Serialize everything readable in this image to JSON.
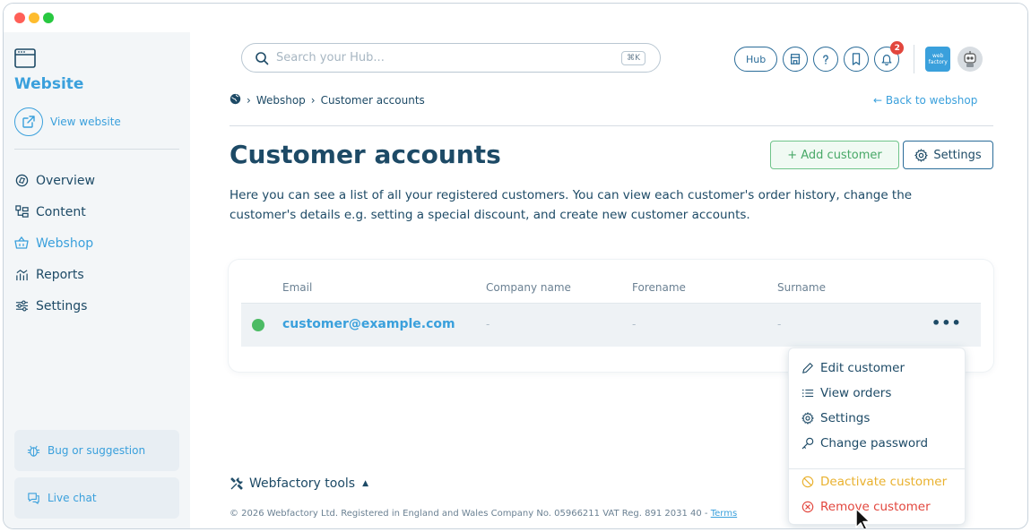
{
  "sidebar": {
    "site_title": "Website",
    "view_website": "View website",
    "nav": [
      {
        "label": "Overview",
        "icon": "overview-icon"
      },
      {
        "label": "Content",
        "icon": "content-icon"
      },
      {
        "label": "Webshop",
        "icon": "basket-icon",
        "active": true
      },
      {
        "label": "Reports",
        "icon": "reports-icon"
      },
      {
        "label": "Settings",
        "icon": "settings-sliders-icon"
      }
    ],
    "bug_label": "Bug or suggestion",
    "chat_label": "Live chat"
  },
  "header": {
    "search_placeholder": "Search your Hub...",
    "search_shortcut": "⌘K",
    "hub_label": "Hub",
    "notification_count": "2",
    "logo_text": "web factory"
  },
  "breadcrumb": {
    "items": [
      "Webshop",
      "Customer accounts"
    ],
    "back_label": "← Back to webshop"
  },
  "main": {
    "title": "Customer accounts",
    "add_customer_label": "+ Add customer",
    "settings_label": "Settings",
    "description": "Here you can see a list of all your registered customers. You can view each customer's order history, change the customer's details e.g. setting a special discount, and create new customer accounts."
  },
  "table": {
    "columns": [
      "Email",
      "Company name",
      "Forename",
      "Surname"
    ],
    "rows": [
      {
        "email": "customer@example.com",
        "company": "-",
        "forename": "-",
        "surname": "-",
        "status_color": "#4cbb64"
      }
    ],
    "more_label": "•••"
  },
  "menu": {
    "items": [
      {
        "label": "Edit customer",
        "icon": "pencil-icon"
      },
      {
        "label": "View orders",
        "icon": "list-icon"
      },
      {
        "label": "Settings",
        "icon": "gear-icon"
      },
      {
        "label": "Change password",
        "icon": "key-icon"
      },
      {
        "label": "Deactivate customer",
        "icon": "ban-icon"
      },
      {
        "label": "Remove customer",
        "icon": "remove-icon"
      }
    ]
  },
  "footer": {
    "tools_label": "Webfactory tools",
    "copyright": "© 2026 Webfactory Ltd. Registered in England and Wales Company No. 05966211 VAT Reg. 891 2031 40 - ",
    "terms_label": "Terms"
  },
  "colors": {
    "accent": "#3aa0dc",
    "primary_text": "#1d4a66",
    "success": "#4cbb64",
    "warning": "#e9b12e",
    "danger": "#e2463d"
  }
}
